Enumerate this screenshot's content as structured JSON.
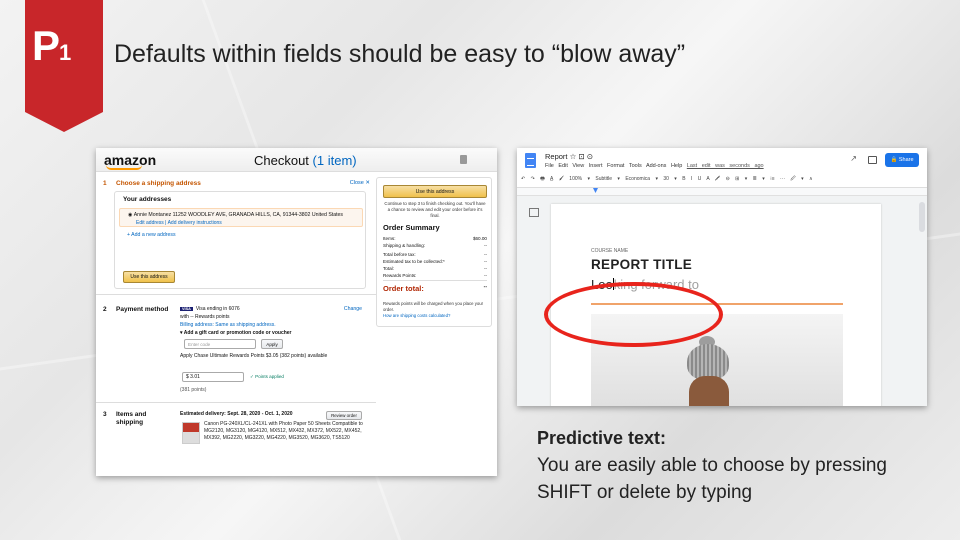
{
  "slide": {
    "badge_letter": "P",
    "badge_number": "1",
    "headline": "Defaults within fields should be easy to “blow away”",
    "accent_color": "#c8262a"
  },
  "amazon": {
    "logo": "amazon",
    "title": "Checkout",
    "item_count": "(1 item)",
    "section1": {
      "number": "1",
      "title": "Choose a shipping address",
      "close": "Close ✕",
      "addresses_heading": "Your addresses",
      "selected_address": "Annie Montanez 11252 WOODLEY AVE, GRANADA HILLS, CA, 91344-3802 United States",
      "address_links": "Edit address | Add delivery instructions",
      "add_new": "+ Add a new address",
      "use_button": "Use this address"
    },
    "summary": {
      "use_button": "Use this address",
      "note": "Continue to step 3 to finish checking out. You'll have a chance to review and edit your order before it's final.",
      "title": "Order Summary",
      "rows": [
        {
          "label": "Items:",
          "value": "$60.00"
        },
        {
          "label": "Shipping & handling:",
          "value": "--"
        },
        {
          "label": "Total before tax:",
          "value": "--"
        },
        {
          "label": "Estimated tax to be collected:*",
          "value": "--"
        },
        {
          "label": "Total:",
          "value": "--"
        },
        {
          "label": "Rewards Points:",
          "value": "--"
        }
      ],
      "order_total_label": "Order total:",
      "order_total_value": "--",
      "footer": "Rewards points will be charged when you place your order.",
      "footer_link": "How are shipping costs calculated?"
    },
    "section2": {
      "number": "2",
      "title": "Payment method",
      "change": "Change",
      "card_badge": "VISA",
      "card_line": "Visa ending in 6076",
      "rewards_line": "with -- Rewards points",
      "billing": "Billing address: Same as shipping address.",
      "gift_toggle": "▾ Add a gift card or promotion code or voucher",
      "code_placeholder": "Enter code",
      "apply": "Apply",
      "rewards_apply": "Apply Chase Ultimate Rewards Points $3.05 (382 points) available",
      "points_value": "$  3.01",
      "points_applied": "✓ Points applied",
      "points_count": "(381 points)"
    },
    "section3": {
      "number": "3",
      "title": "Items and shipping",
      "delivery": "Estimated delivery: Sept. 28, 2020 - Oct. 1, 2020",
      "review_button": "Review order",
      "product": "Canon PG-240XL/CL-241XL with Photo Paper 50 Sheets Compatible to MG2120, MG3120, MG4120, MX512, MX432, MX372, MX522, MX452, MX392, MG2220, MG3220, MG4220, MG3520, MG3620, TS5120"
    }
  },
  "gdocs": {
    "doc_name": "Report  ☆  ⊡  ⊙",
    "menu": "File Edit View Insert Format Tools Add-ons Help",
    "last_edit": "Last edit was seconds ago",
    "share": "🔒 Share",
    "toolbar": "↶ ↷ 🖶 A̲ 🖌 100% ▾ Subtitle ▾ Economica ▾ 30 ▾ B I U A 🖍 ⊖ ⊞ ▾ ≣ ▾ ⁝≡ ··· 🖉 ▾ ∧",
    "course_name": "COURSE NAME",
    "report_title": "REPORT TITLE",
    "typed_text": "Loo",
    "predicted_text": "king forward to",
    "highlight_color": "#e8241c"
  },
  "caption": {
    "title": "Predictive text:",
    "body": "You are easily able to choose by pressing SHIFT or delete by typing"
  }
}
